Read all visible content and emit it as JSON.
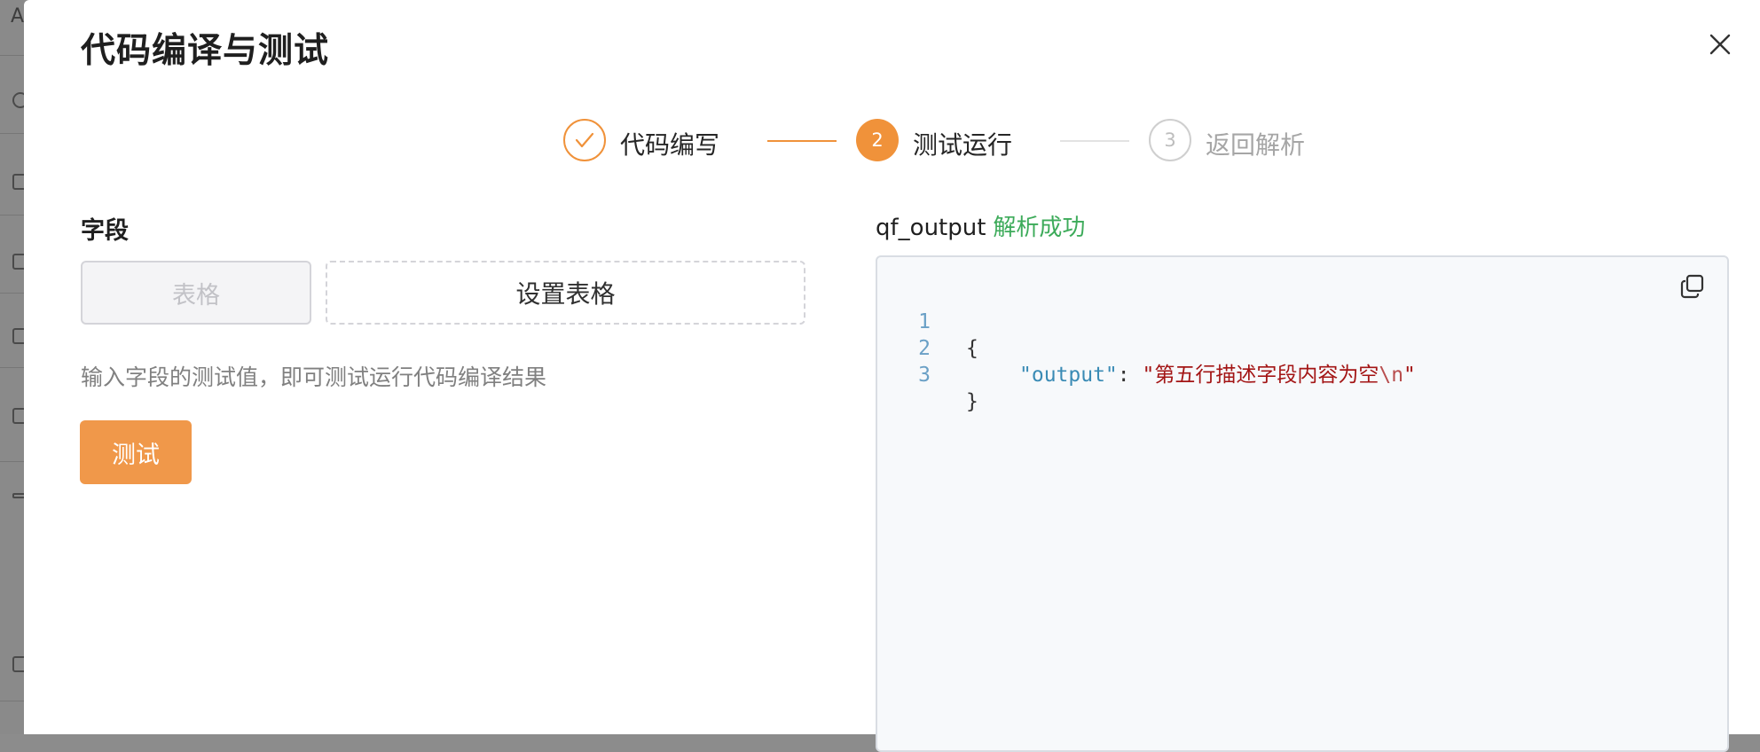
{
  "dialog": {
    "title": "代码编译与测试"
  },
  "steps": [
    {
      "label": "代码编写",
      "state": "done",
      "number": ""
    },
    {
      "label": "测试运行",
      "state": "active",
      "number": "2"
    },
    {
      "label": "返回解析",
      "state": "pending",
      "number": "3"
    }
  ],
  "left": {
    "heading": "字段",
    "field_tag": "表格",
    "set_table_button": "设置表格",
    "hint": "输入字段的测试值，即可测试运行代码编译结果",
    "test_button": "测试"
  },
  "right": {
    "output_name": "qf_output",
    "output_status": "解析成功",
    "code_lines": [
      {
        "no": "1",
        "text": "{"
      },
      {
        "no": "2",
        "key": "\"output\"",
        "colon": ": ",
        "value": "\"第五行描述字段内容为空",
        "escape": "\\n",
        "end": "\""
      },
      {
        "no": "3",
        "text": "}"
      }
    ]
  },
  "colors": {
    "accent": "#f0923a",
    "success": "#3dab5a",
    "pending": "#cfcfcf"
  },
  "icons": {
    "close": "close-icon",
    "check": "check-icon",
    "copy": "copy-icon"
  }
}
